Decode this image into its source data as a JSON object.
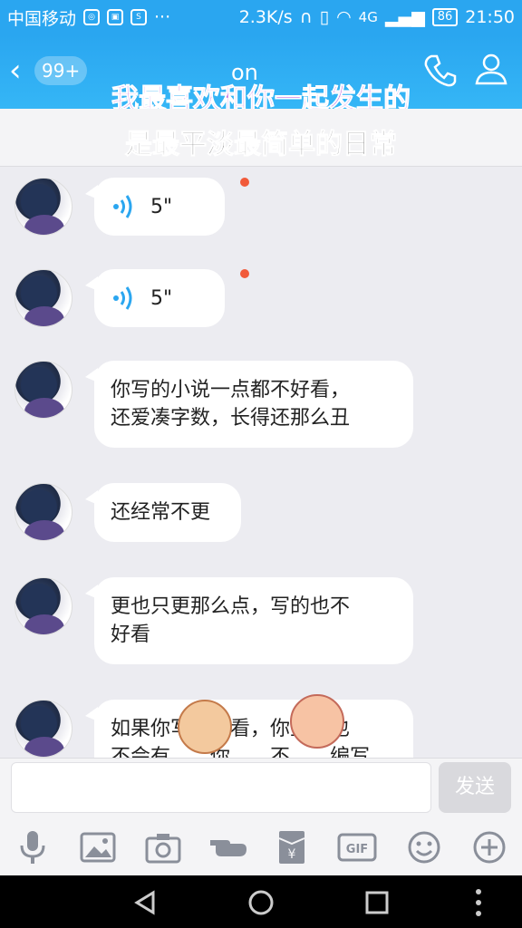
{
  "status_bar": {
    "carrier": "中国移动",
    "net_speed": "2.3K/s",
    "network": "4G",
    "battery": "86",
    "time": "21:50"
  },
  "header": {
    "unread_badge": "99+",
    "nickname": "on",
    "lyric_line1": "我最喜欢和你一起发生的",
    "lyric_line2": "是最平淡最简单的日常"
  },
  "messages": [
    {
      "type": "voice",
      "duration": "5\""
    },
    {
      "type": "voice",
      "duration": "5\""
    },
    {
      "type": "text",
      "lines": [
        "你写的小说一点都不好看，",
        "还爱凑字数，长得还那么丑"
      ]
    },
    {
      "type": "text",
      "lines": [
        "还经常不更"
      ]
    },
    {
      "type": "text",
      "lines": [
        "更也只更那么点，写的也不",
        "好看"
      ]
    },
    {
      "type": "text",
      "lines": [
        "如果你写的好看，你至少也",
        "不会有……你……不……编写"
      ]
    }
  ],
  "input": {
    "placeholder": "",
    "send_label": "发送"
  },
  "toolbar": [
    "microphone-icon",
    "image-icon",
    "camera-icon",
    "hand-icon",
    "red-packet-icon",
    "gif-icon",
    "emoji-icon",
    "plus-icon"
  ],
  "colors": {
    "accent": "#2aa6f0",
    "lyric_purple": "#b44ad8",
    "unread_dot": "#f15a3a"
  }
}
